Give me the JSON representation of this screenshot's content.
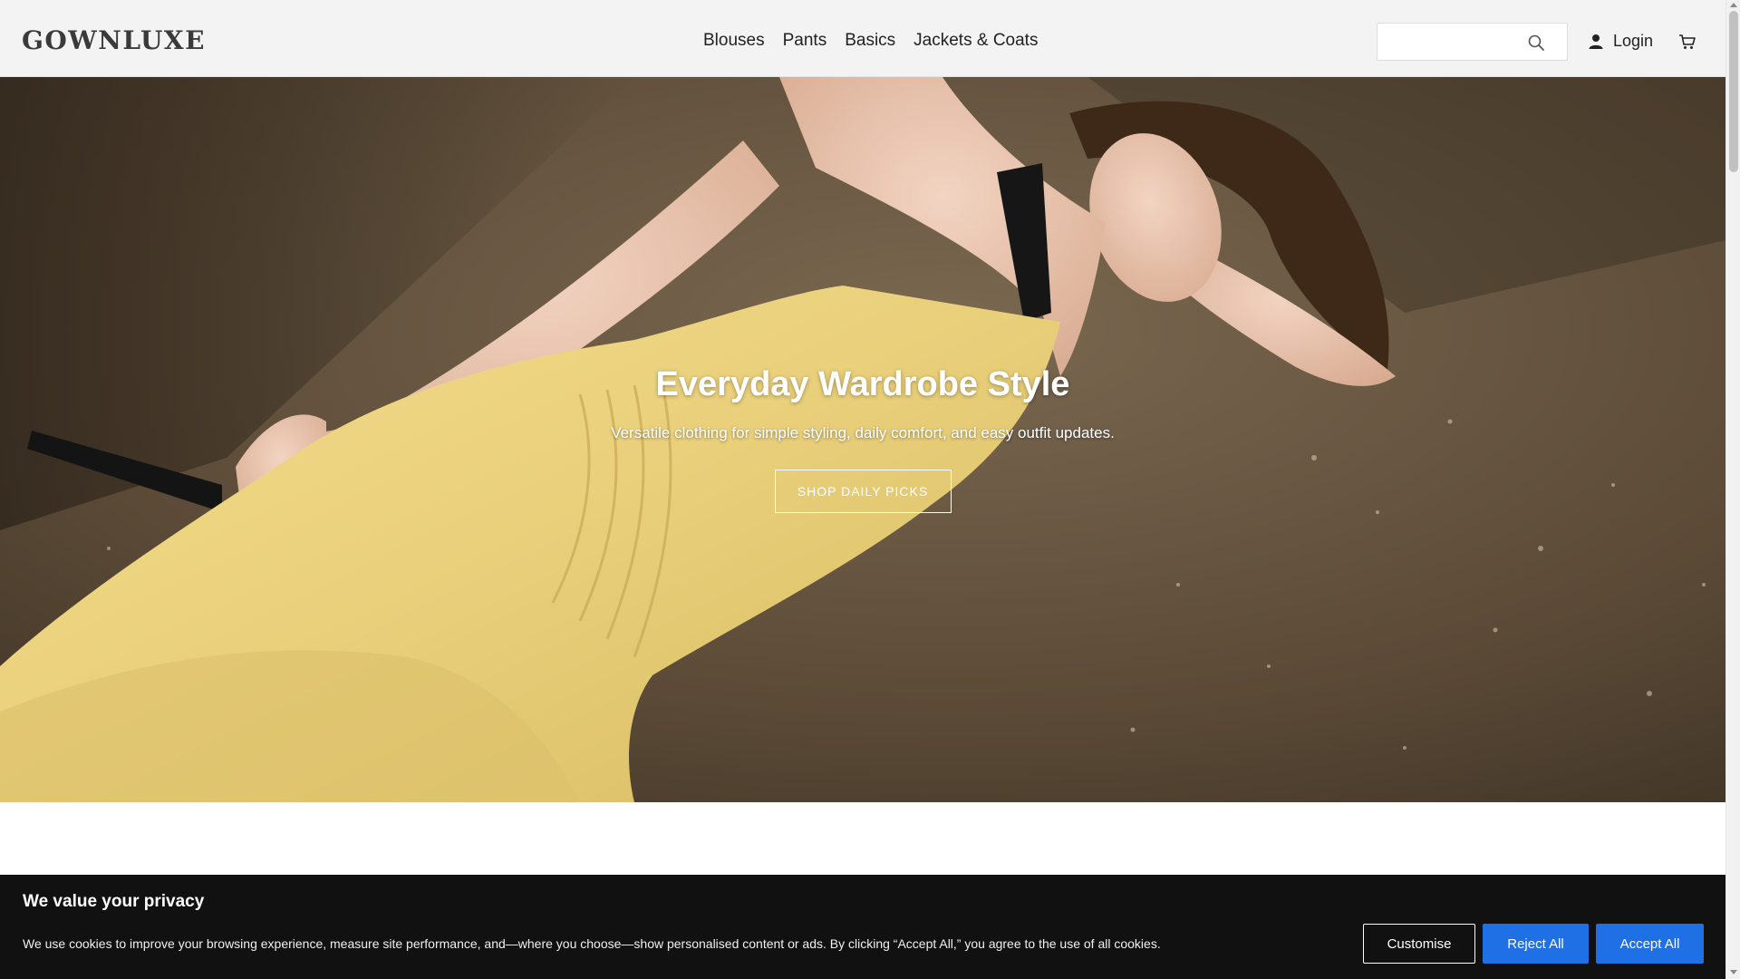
{
  "header": {
    "logo": "GOWNLUXE",
    "nav": [
      "Blouses",
      "Pants",
      "Basics",
      "Jackets & Coats"
    ],
    "search": {
      "value": "",
      "placeholder": ""
    },
    "login_label": "Login",
    "icons": {
      "search": "search-icon",
      "user": "user-icon",
      "cart": "cart-icon"
    }
  },
  "hero": {
    "title": "Everyday Wardrobe Style",
    "subtitle": "Versatile clothing for simple styling, daily comfort, and easy outfit updates.",
    "cta_label": "SHOP DAILY PICKS"
  },
  "cookie_banner": {
    "title": "We value your privacy",
    "text": "We use cookies to improve your browsing experience, measure site performance, and—where you choose—show personalised content or ads. By clicking “Accept All,” you agree to the use of all cookies.",
    "buttons": {
      "customise": "Customise",
      "reject": "Reject All",
      "accept": "Accept All"
    }
  },
  "colors": {
    "header_bg": "#f3f3f3",
    "banner_bg": "#111111",
    "primary_button": "#1f6fe5",
    "dress": "#ecd482",
    "floor": "#5d4c38"
  }
}
